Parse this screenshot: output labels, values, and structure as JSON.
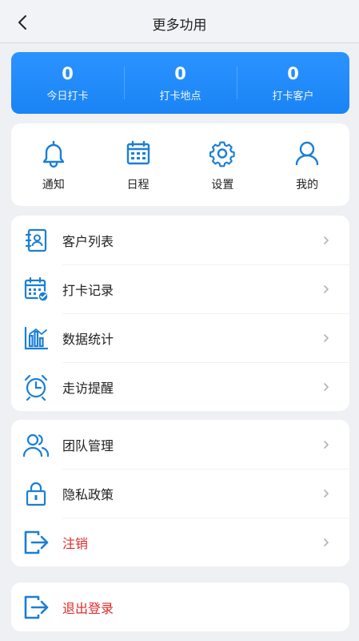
{
  "header": {
    "title": "更多功用"
  },
  "stats": [
    {
      "value": "0",
      "label": "今日打卡"
    },
    {
      "value": "0",
      "label": "打卡地点"
    },
    {
      "value": "0",
      "label": "打卡客户"
    }
  ],
  "quick_actions": [
    {
      "label": "通知",
      "icon": "bell-icon"
    },
    {
      "label": "日程",
      "icon": "calendar-icon"
    },
    {
      "label": "设置",
      "icon": "gear-icon"
    },
    {
      "label": "我的",
      "icon": "user-icon"
    }
  ],
  "menu_group_1": [
    {
      "label": "客户列表",
      "icon": "contacts-book-icon"
    },
    {
      "label": "打卡记录",
      "icon": "calendar-check-icon"
    },
    {
      "label": "数据统计",
      "icon": "bar-chart-icon"
    },
    {
      "label": "走访提醒",
      "icon": "alarm-clock-icon"
    }
  ],
  "menu_group_2": [
    {
      "label": "团队管理",
      "icon": "team-icon"
    },
    {
      "label": "隐私政策",
      "icon": "lock-icon"
    },
    {
      "label": "注销",
      "icon": "exit-icon"
    }
  ],
  "logout": {
    "label": "退出登录",
    "icon": "exit-icon"
  },
  "colors": {
    "accent": "#1a84f5",
    "danger": "#e02b2b",
    "icon": "#1a7fd6"
  }
}
